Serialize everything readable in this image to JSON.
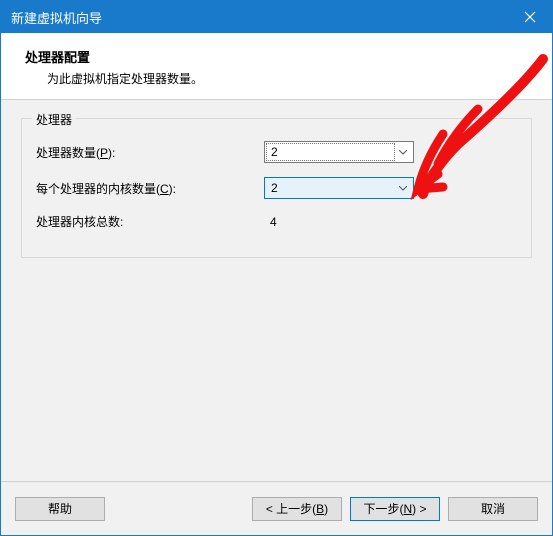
{
  "titlebar": {
    "title": "新建虚拟机向导"
  },
  "header": {
    "heading": "处理器配置",
    "subheading": "为此虚拟机指定处理器数量。"
  },
  "fieldset": {
    "legend": "处理器",
    "rows": {
      "processors": {
        "label_pre": "处理器数量(",
        "label_key": "P",
        "label_post": "):",
        "value": "2"
      },
      "cores": {
        "label_pre": "每个处理器的内核数量(",
        "label_key": "C",
        "label_post": "):",
        "value": "2"
      },
      "total": {
        "label": "处理器内核总数:",
        "value": "4"
      }
    }
  },
  "footer": {
    "help": "帮助",
    "back_pre": "< 上一步(",
    "back_key": "B",
    "back_post": ")",
    "next_pre": "下一步(",
    "next_key": "N",
    "next_post": ") >",
    "cancel": "取消"
  }
}
